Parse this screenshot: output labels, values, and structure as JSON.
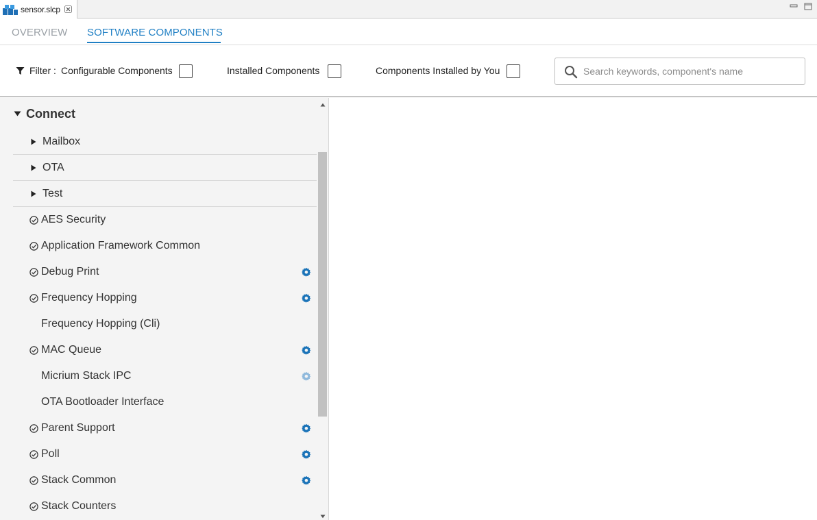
{
  "editor_tab": {
    "title": "sensor.slcp"
  },
  "page_tabs": {
    "overview": "OVERVIEW",
    "software_components": "SOFTWARE COMPONENTS",
    "active": "SOFTWARE COMPONENTS"
  },
  "filter": {
    "label": "Filter :",
    "configurable": {
      "label": "Configurable Components",
      "checked": false
    },
    "installed": {
      "label": "Installed Components",
      "checked": false
    },
    "installed_by_you": {
      "label": "Components Installed by You",
      "checked": false
    }
  },
  "search": {
    "placeholder": "Search keywords, component's name",
    "value": ""
  },
  "tree": {
    "group": {
      "label": "Connect",
      "expanded": true
    },
    "subgroups": [
      {
        "label": "Mailbox"
      },
      {
        "label": "OTA"
      },
      {
        "label": "Test"
      }
    ],
    "components": [
      {
        "label": "AES Security",
        "installed": true,
        "configurable": false
      },
      {
        "label": "Application Framework Common",
        "installed": true,
        "configurable": false
      },
      {
        "label": "Debug Print",
        "installed": true,
        "configurable": true
      },
      {
        "label": "Frequency Hopping",
        "installed": true,
        "configurable": true
      },
      {
        "label": "Frequency Hopping (Cli)",
        "installed": false,
        "configurable": false
      },
      {
        "label": "MAC Queue",
        "installed": true,
        "configurable": true
      },
      {
        "label": "Micrium Stack IPC",
        "installed": false,
        "configurable": true
      },
      {
        "label": "OTA Bootloader Interface",
        "installed": false,
        "configurable": false
      },
      {
        "label": "Parent Support",
        "installed": true,
        "configurable": true
      },
      {
        "label": "Poll",
        "installed": true,
        "configurable": true
      },
      {
        "label": "Stack Common",
        "installed": true,
        "configurable": true
      },
      {
        "label": "Stack Counters",
        "installed": true,
        "configurable": false
      }
    ]
  },
  "colors": {
    "accent": "#1f7fc4",
    "gear": "#1a73b8",
    "gear_faded": "#8fb9dc"
  }
}
